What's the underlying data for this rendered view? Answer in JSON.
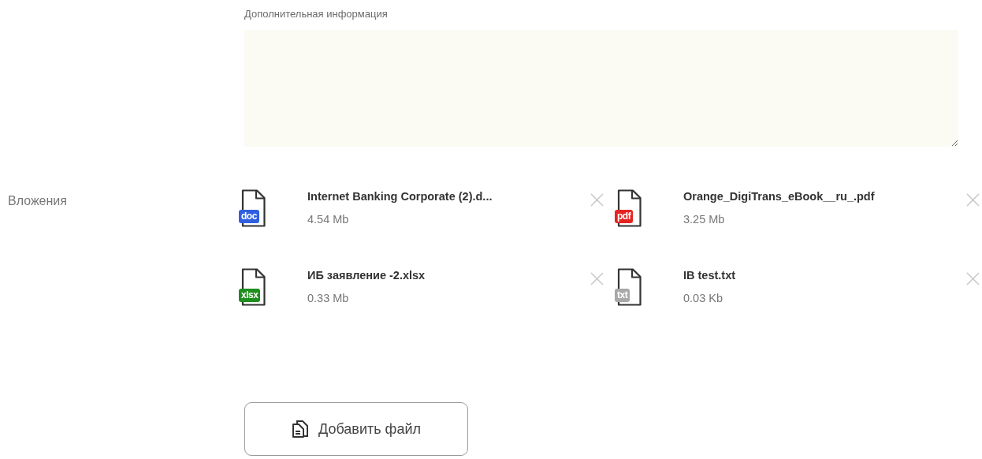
{
  "additional_info": {
    "label": "Дополнительная информация"
  },
  "attachments": {
    "label": "Вложения",
    "files": [
      {
        "name": "Internet Banking Corporate (2).d...",
        "size": "4.54 Mb",
        "badge": "doc",
        "color": "#2f5fe0"
      },
      {
        "name": "Orange_DigiTrans_eBook__ru_.pdf",
        "size": "3.25 Mb",
        "badge": "pdf",
        "color": "#e52421"
      },
      {
        "name": "ИБ заявление -2.xlsx",
        "size": "0.33 Mb",
        "badge": "xlsx",
        "color": "#1e8e1e"
      },
      {
        "name": "IB test.txt",
        "size": "0.03 Kb",
        "badge": "txt",
        "color": "#a8a8a8"
      }
    ]
  },
  "add_button": {
    "label": "Добавить файл"
  }
}
